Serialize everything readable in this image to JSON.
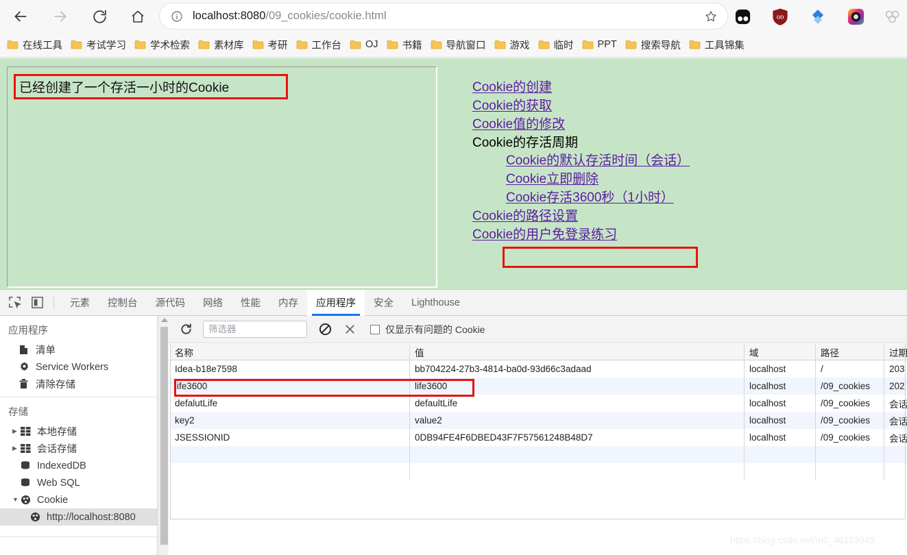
{
  "browser": {
    "back_icon": "back-arrow-icon",
    "forward_icon": "forward-arrow-icon",
    "reload_icon": "reload-icon",
    "home_icon": "home-icon",
    "url_host": "localhost:8080",
    "url_path": "/09_cookies/cookie.html",
    "url_full": "localhost:8080/09_cookies/cookie.html",
    "site_info_icon": "info-circle-icon",
    "bookmark_icon": "star-icon",
    "extensions": [
      {
        "name": "dark-reader-extension-icon",
        "color": "#1a1a1a"
      },
      {
        "name": "ublock-origin-extension-icon",
        "color": "#8b1a1a"
      },
      {
        "name": "blue-diamond-extension-icon",
        "color": "#2f7fe0"
      },
      {
        "name": "camera-extension-icon",
        "color": "#e4405f"
      },
      {
        "name": "puzzle-extensions-icon",
        "color": "#bdbdbd"
      }
    ]
  },
  "bookmarks": [
    {
      "label": "在线工具"
    },
    {
      "label": "考试学习"
    },
    {
      "label": "学术检索"
    },
    {
      "label": "素材库"
    },
    {
      "label": "考研"
    },
    {
      "label": "工作台"
    },
    {
      "label": "OJ"
    },
    {
      "label": "书籍"
    },
    {
      "label": "导航窗口"
    },
    {
      "label": "游戏"
    },
    {
      "label": "临时"
    },
    {
      "label": "PPT"
    },
    {
      "label": "搜索导航"
    },
    {
      "label": "工具锦集"
    }
  ],
  "page": {
    "background_color": "#c6e5c6",
    "highlight_color": "#e8130c",
    "status_text": "已经创建了一个存活一小时的Cookie",
    "links": [
      {
        "label": "Cookie的创建",
        "type": "link",
        "indent": false
      },
      {
        "label": "Cookie的获取",
        "type": "link",
        "indent": false
      },
      {
        "label": "Cookie值的修改",
        "type": "link",
        "indent": false
      },
      {
        "label": "Cookie的存活周期",
        "type": "plain",
        "indent": false
      },
      {
        "label": "Cookie的默认存活时间（会话）",
        "type": "link",
        "indent": true
      },
      {
        "label": "Cookie立即删除",
        "type": "link",
        "indent": true
      },
      {
        "label": "Cookie存活3600秒（1小时）",
        "type": "link",
        "indent": true,
        "highlighted": true
      },
      {
        "label": "Cookie的路径设置",
        "type": "link",
        "indent": false
      },
      {
        "label": "Cookie的用户免登录练习",
        "type": "link",
        "indent": false
      }
    ]
  },
  "devtools": {
    "inspect_icon": "inspect-element-icon",
    "device_icon": "device-toolbar-icon",
    "tabs": [
      {
        "label": "元素",
        "active": false
      },
      {
        "label": "控制台",
        "active": false
      },
      {
        "label": "源代码",
        "active": false
      },
      {
        "label": "网络",
        "active": false
      },
      {
        "label": "性能",
        "active": false
      },
      {
        "label": "内存",
        "active": false
      },
      {
        "label": "应用程序",
        "active": true
      },
      {
        "label": "安全",
        "active": false
      },
      {
        "label": "Lighthouse",
        "active": false
      }
    ],
    "accent_color": "#1a73e8",
    "sidebar": {
      "application_title": "应用程序",
      "application_items": [
        {
          "label": "清单",
          "icon": "manifest-file-icon"
        },
        {
          "label": "Service Workers",
          "icon": "gear-icon"
        },
        {
          "label": "清除存储",
          "icon": "trash-icon"
        }
      ],
      "storage_title": "存储",
      "storage_items": [
        {
          "label": "本地存储",
          "icon": "grid-storage-icon",
          "arrow": "▶",
          "selected": false
        },
        {
          "label": "会话存储",
          "icon": "grid-storage-icon",
          "arrow": "▶",
          "selected": false
        },
        {
          "label": "IndexedDB",
          "icon": "database-icon",
          "arrow": "",
          "selected": false
        },
        {
          "label": "Web SQL",
          "icon": "database-icon",
          "arrow": "",
          "selected": false
        },
        {
          "label": "Cookie",
          "icon": "cookie-icon",
          "arrow": "▼",
          "selected": false
        }
      ],
      "cookie_origin": {
        "label": "http://localhost:8080",
        "icon": "cookie-icon",
        "selected": true
      }
    },
    "cookie_toolbar": {
      "refresh_icon": "refresh-icon",
      "filter_placeholder": "筛选器",
      "filter_value": "",
      "clear_all_icon": "block-clear-icon",
      "delete_icon": "close-x-icon",
      "issues_checkbox_label": "仅显示有问题的 Cookie",
      "issues_checked": false
    },
    "cookie_table": {
      "columns": [
        "名称",
        "值",
        "域",
        "路径",
        "过期"
      ],
      "rows": [
        {
          "name": "Idea-b18e7598",
          "value": "bb704224-27b3-4814-ba0d-93d66c3adaad",
          "domain": "localhost",
          "path": "/",
          "expires": "203"
        },
        {
          "name": "life3600",
          "value": "life3600",
          "domain": "localhost",
          "path": "/09_cookies",
          "expires": "202",
          "highlighted": true
        },
        {
          "name": "defalutLife",
          "value": "defaultLife",
          "domain": "localhost",
          "path": "/09_cookies",
          "expires": "会话"
        },
        {
          "name": "key2",
          "value": "value2",
          "domain": "localhost",
          "path": "/09_cookies",
          "expires": "会话"
        },
        {
          "name": "JSESSIONID",
          "value": "0DB94FE4F6DBED43F7F57561248B48D7",
          "domain": "localhost",
          "path": "/09_cookies",
          "expires": "会话"
        },
        {
          "name": "",
          "value": "",
          "domain": "",
          "path": "",
          "expires": ""
        },
        {
          "name": "",
          "value": "",
          "domain": "",
          "path": "",
          "expires": ""
        }
      ]
    }
  },
  "watermark": "https://blog.csdn.net/m0_46153949"
}
